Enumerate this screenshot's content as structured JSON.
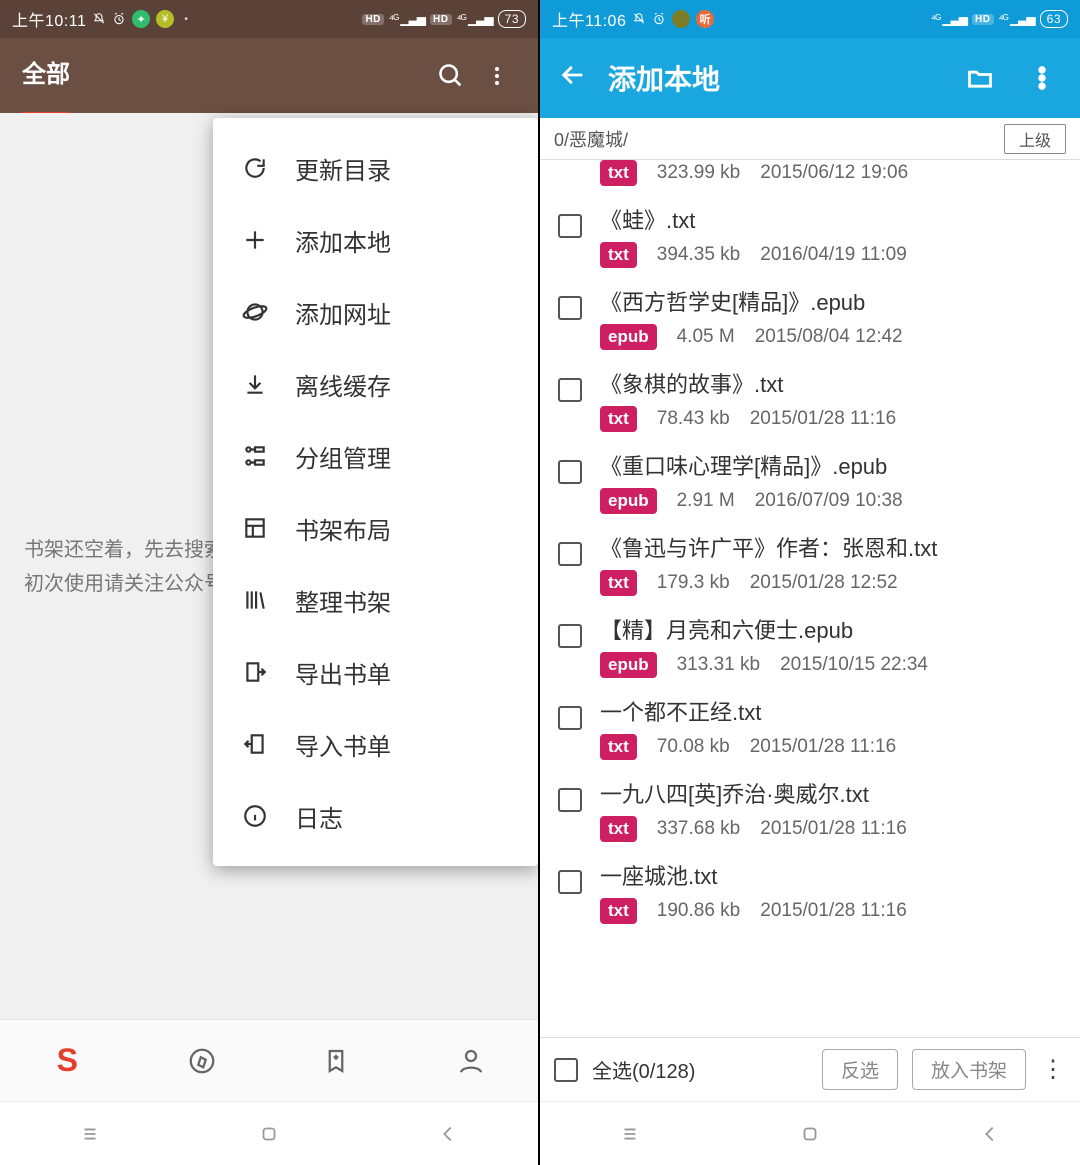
{
  "left": {
    "status": {
      "time": "上午10:11",
      "battery": "73"
    },
    "appbar": {
      "tab": "全部"
    },
    "empty": {
      "line1": "书架还空着，先去搜索",
      "line2": "初次使用请关注公众号"
    },
    "menu": [
      {
        "icon": "refresh",
        "label": "更新目录"
      },
      {
        "icon": "plus",
        "label": "添加本地"
      },
      {
        "icon": "planet",
        "label": "添加网址"
      },
      {
        "icon": "download",
        "label": "离线缓存"
      },
      {
        "icon": "groups",
        "label": "分组管理"
      },
      {
        "icon": "layout",
        "label": "书架布局"
      },
      {
        "icon": "library",
        "label": "整理书架"
      },
      {
        "icon": "export",
        "label": "导出书单"
      },
      {
        "icon": "import",
        "label": "导入书单"
      },
      {
        "icon": "log",
        "label": "日志"
      }
    ]
  },
  "right": {
    "status": {
      "time": "上午11:06",
      "battery": "63"
    },
    "appbar": {
      "title": "添加本地"
    },
    "path": "0/恶魔城/",
    "up_label": "上级",
    "files": [
      {
        "name": "",
        "badge": "txt",
        "size": "323.99 kb",
        "date": "2015/06/12 19:06"
      },
      {
        "name": "《蛙》.txt",
        "badge": "txt",
        "size": "394.35 kb",
        "date": "2016/04/19 11:09"
      },
      {
        "name": "《西方哲学史[精品]》.epub",
        "badge": "epub",
        "size": "4.05 M",
        "date": "2015/08/04 12:42"
      },
      {
        "name": "《象棋的故事》.txt",
        "badge": "txt",
        "size": "78.43 kb",
        "date": "2015/01/28 11:16"
      },
      {
        "name": "《重口味心理学[精品]》.epub",
        "badge": "epub",
        "size": "2.91 M",
        "date": "2016/07/09 10:38"
      },
      {
        "name": "《鲁迅与许广平》作者：张恩和.txt",
        "badge": "txt",
        "size": "179.3 kb",
        "date": "2015/01/28 12:52"
      },
      {
        "name": "【精】月亮和六便士.epub",
        "badge": "epub",
        "size": "313.31 kb",
        "date": "2015/10/15 22:34"
      },
      {
        "name": "一个都不正经.txt",
        "badge": "txt",
        "size": "70.08 kb",
        "date": "2015/01/28 11:16"
      },
      {
        "name": "一九八四[英]乔治·奥威尔.txt",
        "badge": "txt",
        "size": "337.68 kb",
        "date": "2015/01/28 11:16"
      },
      {
        "name": "一座城池.txt",
        "badge": "txt",
        "size": "190.86 kb",
        "date": "2015/01/28 11:16"
      }
    ],
    "selectbar": {
      "label": "全选(0/128)",
      "invert": "反选",
      "add": "放入书架"
    }
  }
}
